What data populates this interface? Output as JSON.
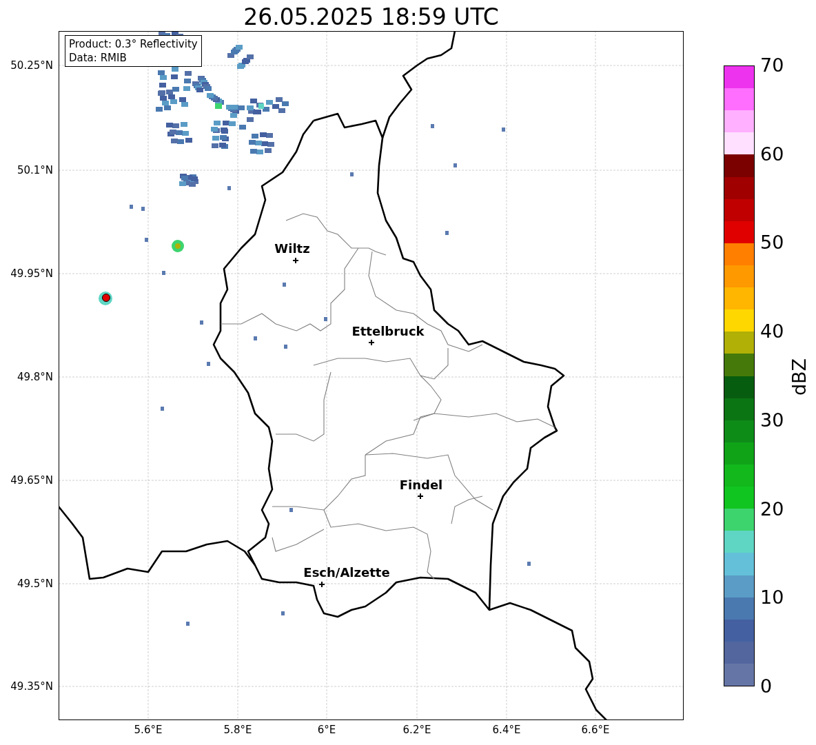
{
  "title": "26.05.2025 18:59 UTC",
  "info_box": {
    "lines": [
      "Product: 0.3° Reflectivity",
      "Data: RMIB"
    ]
  },
  "map": {
    "y_ticks": [
      "50.25°N",
      "50.1°N",
      "49.95°N",
      "49.8°N",
      "49.65°N",
      "49.5°N",
      "49.35°N"
    ],
    "x_ticks": [
      "5.6°E",
      "5.8°E",
      "6°E",
      "6.2°E",
      "6.4°E",
      "6.6°E"
    ],
    "places": [
      {
        "name": "Wiltz"
      },
      {
        "name": "Ettelbruck"
      },
      {
        "name": "Findel"
      },
      {
        "name": "Esch/Alzette"
      }
    ]
  },
  "colorbar": {
    "label": "dBZ",
    "ticks": [
      "70",
      "60",
      "50",
      "40",
      "30",
      "20",
      "10",
      "0"
    ],
    "bands": [
      {
        "color": "#ee33ee"
      },
      {
        "color": "#ff6eff"
      },
      {
        "color": "#ffb0ff"
      },
      {
        "color": "#ffe0ff"
      },
      {
        "color": "#7b0000"
      },
      {
        "color": "#a00000"
      },
      {
        "color": "#c00000"
      },
      {
        "color": "#e00000"
      },
      {
        "color": "#ff7f00"
      },
      {
        "color": "#ff9900"
      },
      {
        "color": "#ffb600"
      },
      {
        "color": "#ffd700"
      },
      {
        "color": "#b0b007"
      },
      {
        "color": "#457a0a"
      },
      {
        "color": "#075d0f"
      },
      {
        "color": "#0b7514"
      },
      {
        "color": "#0e8c18"
      },
      {
        "color": "#10a318"
      },
      {
        "color": "#12b81c"
      },
      {
        "color": "#11c520"
      },
      {
        "color": "#3dd46e"
      },
      {
        "color": "#5fd6c4"
      },
      {
        "color": "#63c0d8"
      },
      {
        "color": "#5a9cc6"
      },
      {
        "color": "#4a79b0"
      },
      {
        "color": "#4460a0"
      },
      {
        "color": "#53669e"
      },
      {
        "color": "#6575a5"
      }
    ]
  }
}
